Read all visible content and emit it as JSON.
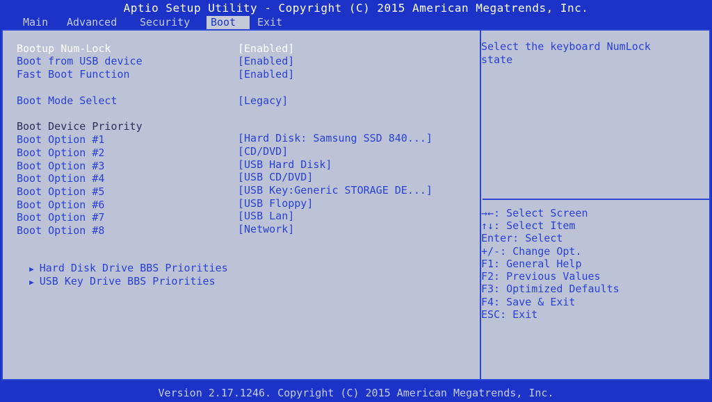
{
  "title": "Aptio Setup Utility - Copyright (C) 2015 American Megatrends, Inc.",
  "tabs": [
    "Main",
    "Advanced",
    "Security",
    "Boot",
    "Exit"
  ],
  "active_tab": "Boot",
  "settings": [
    {
      "label": "Bootup Num-Lock",
      "value": "[Enabled]"
    },
    {
      "label": "Boot from USB device",
      "value": "[Enabled]"
    },
    {
      "label": "Fast Boot Function",
      "value": "[Enabled]"
    },
    {
      "label": "Boot Mode Select",
      "value": "[Legacy]"
    }
  ],
  "priority_heading": "Boot Device Priority",
  "boot_options": [
    {
      "label": "Boot Option #1",
      "value": "[Hard Disk: Samsung SSD 840...]"
    },
    {
      "label": "Boot Option #2",
      "value": "[CD/DVD]"
    },
    {
      "label": "Boot Option #3",
      "value": "[USB Hard Disk]"
    },
    {
      "label": "Boot Option #4",
      "value": "[USB CD/DVD]"
    },
    {
      "label": "Boot Option #5",
      "value": "[USB Key:Generic STORAGE DE...]"
    },
    {
      "label": "Boot Option #6",
      "value": "[USB Floppy]"
    },
    {
      "label": "Boot Option #7",
      "value": "[USB Lan]"
    },
    {
      "label": "Boot Option #8",
      "value": "[Network]"
    }
  ],
  "submenus": [
    "Hard Disk Drive BBS Priorities",
    "USB Key Drive BBS Priorities"
  ],
  "help": {
    "line1": "Select the keyboard NumLock",
    "line2": "state"
  },
  "keys": [
    "→←: Select Screen",
    "↑↓: Select Item",
    "Enter: Select",
    "+/-: Change Opt.",
    "F1: General Help",
    "F2: Previous Values",
    "F3: Optimized Defaults",
    "F4: Save & Exit",
    "ESC: Exit"
  ],
  "footer": "Version 2.17.1246. Copyright (C) 2015 American Megatrends, Inc.",
  "colors": {
    "frame_blue": "#1c33c8",
    "panel_gray": "#bcc3d6",
    "text_blue": "#2b3fd2",
    "highlight_white": "#ffffff"
  }
}
